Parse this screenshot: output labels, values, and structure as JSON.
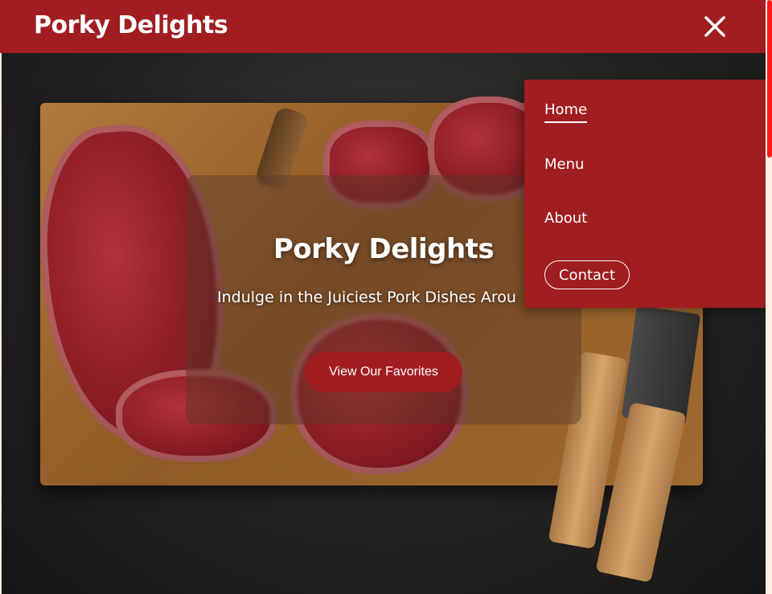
{
  "header": {
    "brand": "Porky Delights",
    "close_icon": "close-icon"
  },
  "nav": {
    "items": [
      {
        "label": "Home",
        "active": true
      },
      {
        "label": "Menu"
      },
      {
        "label": "About"
      },
      {
        "label": "Contact",
        "style": "outlined-pill"
      }
    ]
  },
  "hero": {
    "title": "Porky Delights",
    "subtitle": "Indulge in the Juiciest Pork Dishes Arou",
    "cta_label": "View Our Favorites"
  },
  "colors": {
    "brand_red": "#a01d20",
    "scroll_thumb": "#ff1a1a",
    "page_bg": "#fbeee3"
  }
}
